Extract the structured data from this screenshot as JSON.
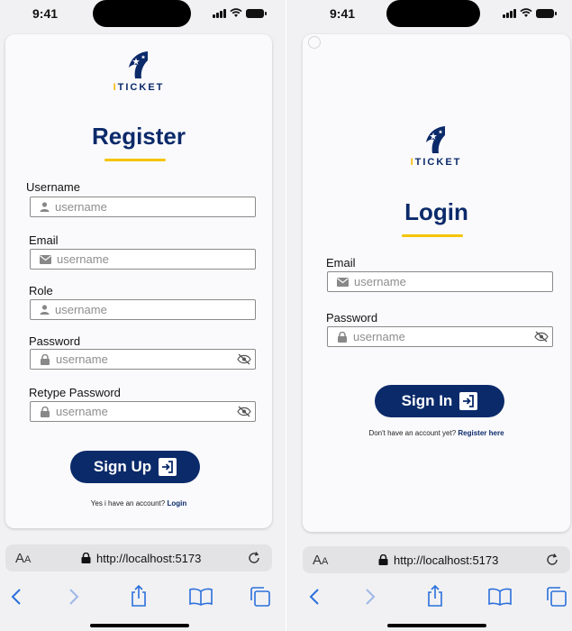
{
  "status": {
    "time": "9:41"
  },
  "register": {
    "logo_text_i": "I",
    "logo_text_rest": "TICKET",
    "title": "Register",
    "fields": [
      {
        "label": "Username",
        "placeholder": "username",
        "icon": "user-icon"
      },
      {
        "label": "Email",
        "placeholder": "username",
        "icon": "mail-icon"
      },
      {
        "label": "Role",
        "placeholder": "username",
        "icon": "user-icon"
      },
      {
        "label": "Password",
        "placeholder": "username",
        "icon": "lock-icon"
      },
      {
        "label": "Retype Password",
        "placeholder": "username",
        "icon": "lock-icon"
      }
    ],
    "button_label": "Sign Up",
    "footer_text": "Yes i have an account?",
    "footer_link": "Login"
  },
  "login": {
    "logo_text_i": "I",
    "logo_text_rest": "TICKET",
    "title": "Login",
    "fields": [
      {
        "label": "Email",
        "placeholder": "username",
        "icon": "mail-icon"
      },
      {
        "label": "Password",
        "placeholder": "username",
        "icon": "lock-icon"
      }
    ],
    "button_label": "Sign In",
    "footer_text": "Don't have an account yet?",
    "footer_link": "Register here"
  },
  "browser": {
    "aa_label": "A",
    "aa_small": "A",
    "url": "http://localhost:5173"
  },
  "colors": {
    "brand": "#0b2a6a",
    "accent": "#f5c400"
  }
}
